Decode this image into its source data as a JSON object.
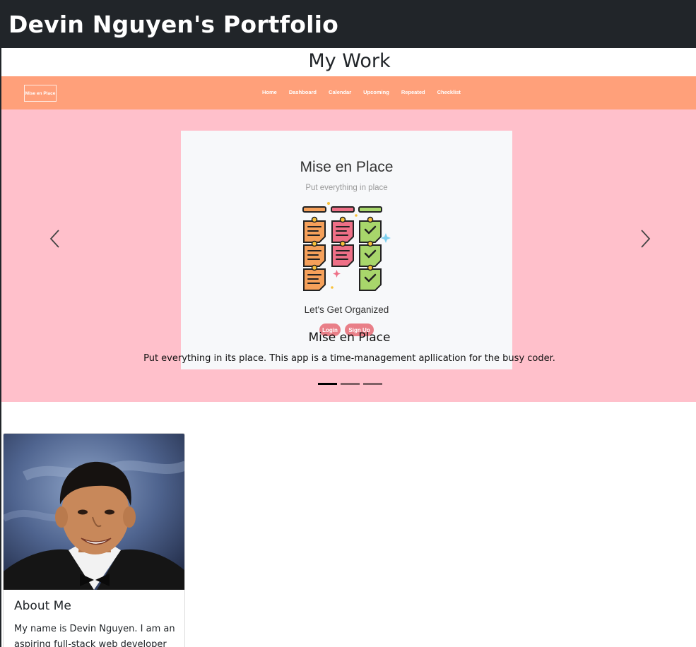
{
  "header": {
    "brand": "Devin Nguyen's Portfolio"
  },
  "main": {
    "section_title": "My Work"
  },
  "carousel": {
    "background_color": "#ffc0cb",
    "embedded_app": {
      "nav_color": "#ffa07a",
      "logo_text": "Mise en Place",
      "nav_links": [
        "Home",
        "Dashboard",
        "Calendar",
        "Upcoming",
        "Repeated",
        "Checklist"
      ],
      "title": "Mise en Place",
      "subtitle": "Put everything in place",
      "cta": "Let's Get Organized",
      "login_label": "Login",
      "signup_label": "Sign Up",
      "accent_color": "#e97f88"
    },
    "caption": {
      "title": "Mise en Place",
      "text": "Put everything in its place. This app is a time-management apllication for the busy coder."
    },
    "slide_count": 3,
    "active_slide": 1,
    "prev_icon": "chevron-left-icon",
    "next_icon": "chevron-right-icon"
  },
  "about_card": {
    "title": "About Me",
    "text": "My name is Devin Nguyen. I am an aspiring full-stack web developer"
  }
}
